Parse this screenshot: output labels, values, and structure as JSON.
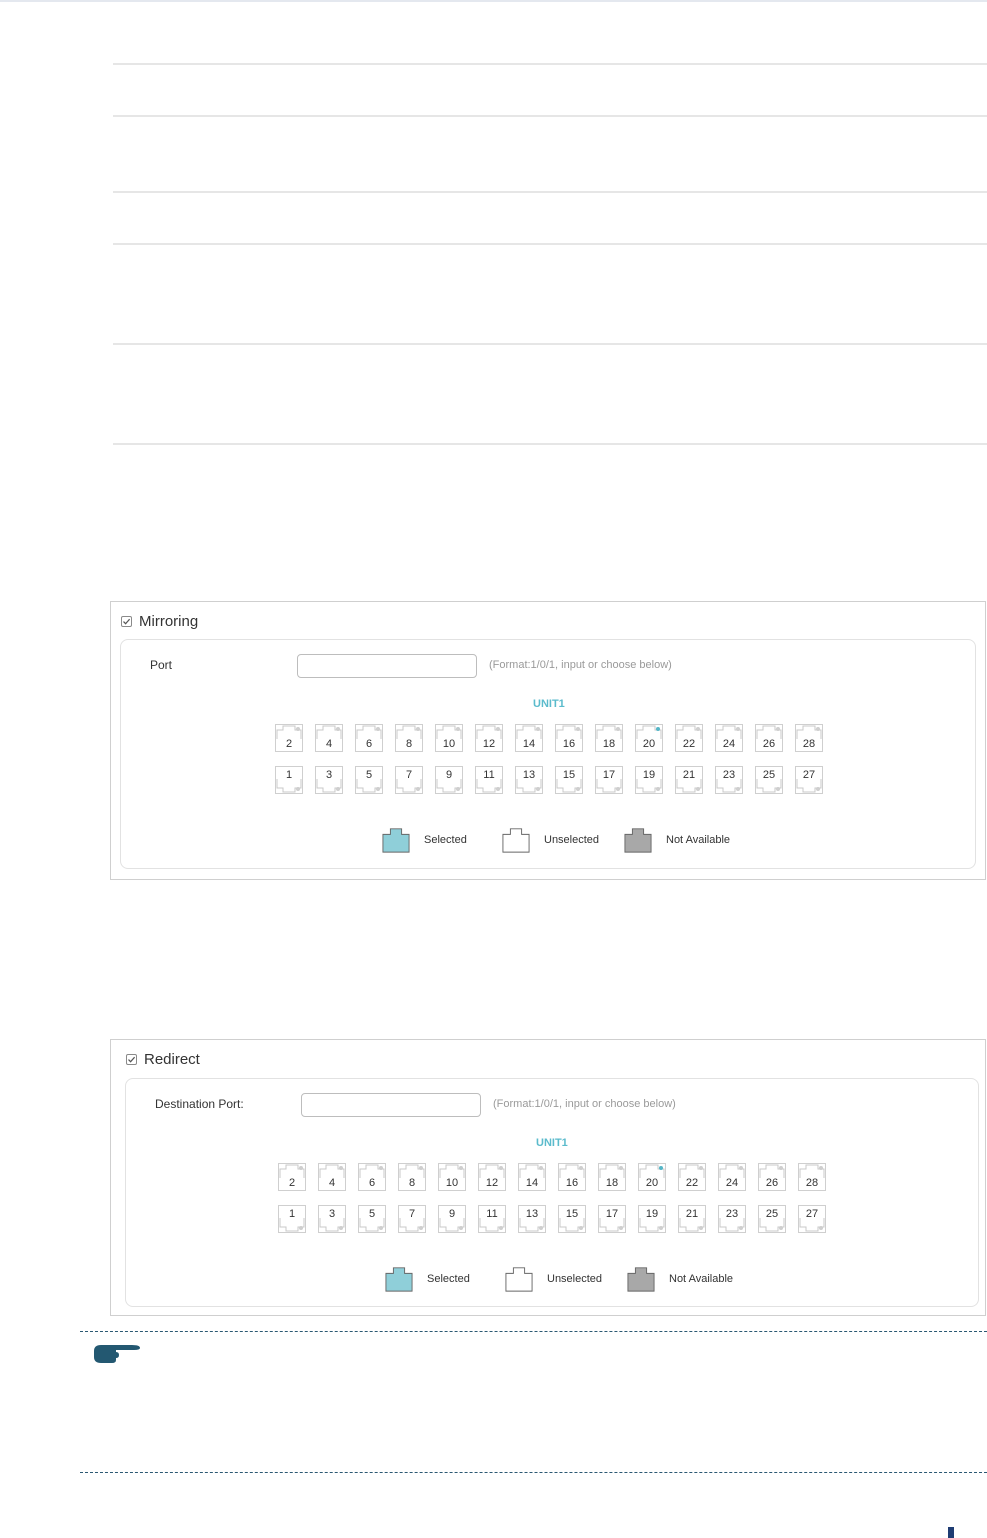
{
  "mirroring": {
    "checked": true,
    "title": "Mirroring",
    "port_label": "Port",
    "port_value": "",
    "hint": "(Format:1/0/1, input or choose below)",
    "unit_label": "UNIT1",
    "ports_top": [
      "2",
      "4",
      "6",
      "8",
      "10",
      "12",
      "14",
      "16",
      "18",
      "20",
      "22",
      "24",
      "26",
      "28"
    ],
    "ports_bottom": [
      "1",
      "3",
      "5",
      "7",
      "9",
      "11",
      "13",
      "15",
      "17",
      "19",
      "21",
      "23",
      "25",
      "27"
    ],
    "active_port": "20",
    "legend": {
      "selected": "Selected",
      "unselected": "Unselected",
      "not_available": "Not Available"
    }
  },
  "redirect": {
    "checked": true,
    "title": "Redirect",
    "port_label": "Destination Port:",
    "port_value": "",
    "hint": "(Format:1/0/1, input or choose below)",
    "unit_label": "UNIT1",
    "ports_top": [
      "2",
      "4",
      "6",
      "8",
      "10",
      "12",
      "14",
      "16",
      "18",
      "20",
      "22",
      "24",
      "26",
      "28"
    ],
    "ports_bottom": [
      "1",
      "3",
      "5",
      "7",
      "9",
      "11",
      "13",
      "15",
      "17",
      "19",
      "21",
      "23",
      "25",
      "27"
    ],
    "active_port": "20",
    "legend": {
      "selected": "Selected",
      "unselected": "Unselected",
      "not_available": "Not Available"
    }
  },
  "colors": {
    "selected": "#8fcfd9",
    "unselected": "#ffffff",
    "not_available": "#a8a8a8",
    "accent": "#5bbbcc",
    "note_rule": "#2b5872"
  },
  "icons": {
    "note": "pointing-hand-icon",
    "checkbox": "checkmark-icon"
  }
}
